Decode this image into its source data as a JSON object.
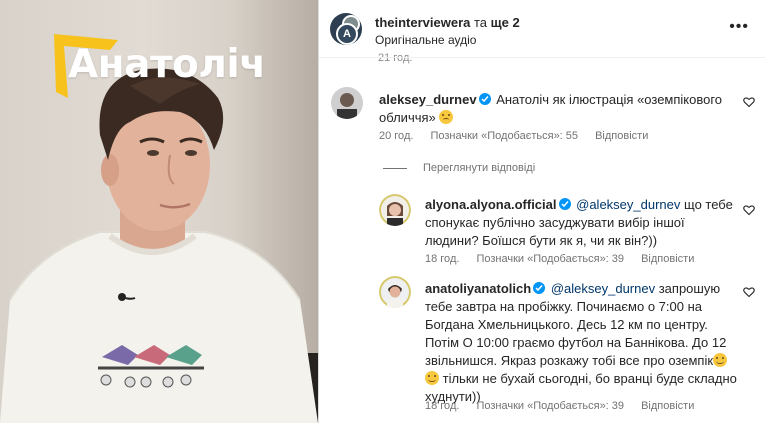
{
  "media": {
    "logo_text": "Анатоліч",
    "accent_color": "#f6c21b"
  },
  "post_header": {
    "username": "theinterviewera",
    "joiner": "та",
    "others": "ще 2",
    "audio_label": "Оригінальне аудіо",
    "more_icon": "more-horizontal-icon"
  },
  "previous_time_stub": "21 год.",
  "comments": [
    {
      "username": "aleksey_durnev",
      "text": "Анатоліч як ілюстрація «оземпікового обличчя»",
      "time": "20 год.",
      "likes": "Позначки «Подобається»: 55",
      "reply": "Відповісти",
      "emoji": "sad-face-emoji"
    }
  ],
  "view_replies_label": "Переглянути відповіді",
  "replies": [
    {
      "username": "alyona.alyona.official",
      "mention": "@aleksey_durnev",
      "text": "що тебе спонукає публічно засуджувати вибір іншої людини? Боїшся бути як я, чи як він?))",
      "time": "18 год.",
      "likes": "Позначки «Подобається»: 39",
      "reply": "Відповісти"
    },
    {
      "username": "anatoliyanatolich",
      "mention": "@aleksey_durnev",
      "text_1": "запрошую тебе завтра на пробіжку. Починаємо о 7:00 на Богдана Хмельницького. Десь 12 км по центру. Потім О 10:00 граємо футбол на Баннікова. До 12 звільнишся. Якраз розкажу тобі все про оземпік",
      "text_2": "тільки не бухай сьогодні, бо вранці буде складно худнути))",
      "time": "18 год.",
      "likes": "Позначки «Подобається»: 39",
      "reply": "Відповісти"
    }
  ]
}
